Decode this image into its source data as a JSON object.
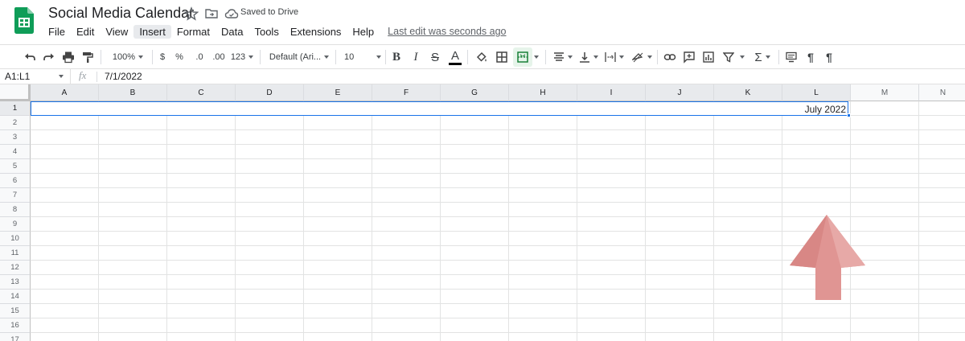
{
  "app": {
    "title": "Social Media Calendar",
    "saved_status": "Saved to Drive",
    "last_edit": "Last edit was seconds ago",
    "accent_color": "#1a73e8",
    "logo_color": "#0f9d58"
  },
  "menu": {
    "items": [
      "File",
      "Edit",
      "View",
      "Insert",
      "Format",
      "Data",
      "Tools",
      "Extensions",
      "Help"
    ],
    "active": "Insert"
  },
  "toolbar": {
    "zoom": "100%",
    "currency": "$",
    "percent": "%",
    "decrease_decimal": ".0",
    "increase_decimal": ".00",
    "number_format": "123",
    "font": "Default (Ari...",
    "font_size": "10",
    "bold": "B",
    "italic": "I",
    "strikethrough": "S",
    "text_color": "A",
    "icons": [
      "undo-icon",
      "redo-icon",
      "print-icon",
      "paint-format-icon",
      "fill-color-icon",
      "borders-icon",
      "merge-cells-icon",
      "horizontal-align-icon",
      "vertical-align-icon",
      "text-wrap-icon",
      "text-rotation-icon",
      "link-icon",
      "comment-icon",
      "chart-icon",
      "filter-icon",
      "functions-icon",
      "ltr-icon",
      "rtl-icon"
    ]
  },
  "formula_bar": {
    "name_box": "A1:L1",
    "fx": "fx",
    "value": "7/1/2022"
  },
  "grid": {
    "columns": [
      "A",
      "B",
      "C",
      "D",
      "E",
      "F",
      "G",
      "H",
      "I",
      "J",
      "K",
      "L",
      "M",
      "N"
    ],
    "rows": [
      "1",
      "2",
      "3",
      "4",
      "5",
      "6",
      "7",
      "8",
      "9",
      "10",
      "11",
      "12",
      "13",
      "14",
      "15",
      "16",
      "17"
    ],
    "selected_range": "A1:L1",
    "merged_cell_value": "July 2022",
    "annotation_arrow_color": "#e09593"
  }
}
